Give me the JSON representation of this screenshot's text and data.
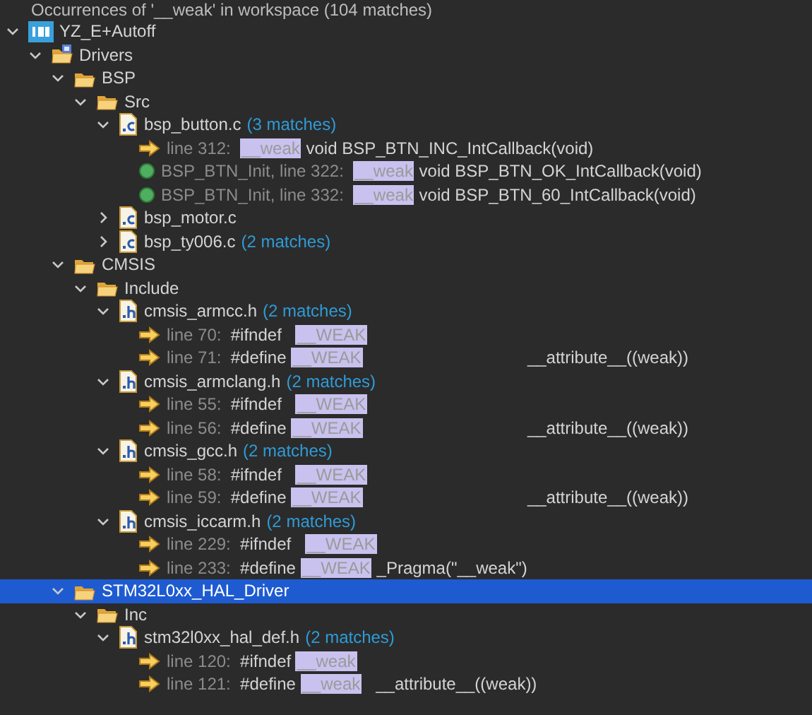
{
  "header": "Occurrences of '__weak' in workspace (104 matches)",
  "tree": [
    {
      "kind": "project",
      "label": "YZ_E+Autoff",
      "expanded": true,
      "selected": false,
      "children": [
        {
          "kind": "source-folder",
          "label": "Drivers",
          "expanded": true,
          "selected": false,
          "children": [
            {
              "kind": "folder",
              "label": "BSP",
              "expanded": true,
              "selected": false,
              "children": [
                {
                  "kind": "folder",
                  "label": "Src",
                  "expanded": true,
                  "selected": false,
                  "children": [
                    {
                      "kind": "c-file",
                      "label": "bsp_button.c",
                      "count": "(3 matches)",
                      "expanded": true,
                      "selected": false,
                      "children": [
                        {
                          "kind": "line-match",
                          "location": "line 312:",
                          "highlight": "__weak",
                          "after": " void BSP_BTN_INC_IntCallback(void)"
                        },
                        {
                          "kind": "method-match",
                          "location": "BSP_BTN_Init, line 322:",
                          "highlight": "__weak",
                          "after": " void BSP_BTN_OK_IntCallback(void)"
                        },
                        {
                          "kind": "method-match",
                          "location": "BSP_BTN_Init, line 332:",
                          "highlight": "__weak",
                          "after": " void BSP_BTN_60_IntCallback(void)"
                        }
                      ]
                    },
                    {
                      "kind": "c-file",
                      "label": "bsp_motor.c",
                      "expanded": false,
                      "selected": false
                    },
                    {
                      "kind": "c-file",
                      "label": "bsp_ty006.c",
                      "count": "(2 matches)",
                      "expanded": false,
                      "selected": false
                    }
                  ]
                }
              ]
            },
            {
              "kind": "folder",
              "label": "CMSIS",
              "expanded": true,
              "selected": false,
              "children": [
                {
                  "kind": "folder",
                  "label": "Include",
                  "expanded": true,
                  "selected": false,
                  "children": [
                    {
                      "kind": "h-file",
                      "label": "cmsis_armcc.h",
                      "count": "(2 matches)",
                      "expanded": true,
                      "selected": false,
                      "children": [
                        {
                          "kind": "line-match",
                          "location": "line 70:",
                          "before": "#ifndef   ",
                          "highlight": "__WEAK"
                        },
                        {
                          "kind": "line-match",
                          "location": "line 71:",
                          "before": "#define ",
                          "highlight": "__WEAK",
                          "after": "                                   __attribute__((weak))"
                        }
                      ]
                    },
                    {
                      "kind": "h-file",
                      "label": "cmsis_armclang.h",
                      "count": "(2 matches)",
                      "expanded": true,
                      "selected": false,
                      "children": [
                        {
                          "kind": "line-match",
                          "location": "line 55:",
                          "before": "#ifndef   ",
                          "highlight": "__WEAK"
                        },
                        {
                          "kind": "line-match",
                          "location": "line 56:",
                          "before": "#define ",
                          "highlight": "__WEAK",
                          "after": "                                   __attribute__((weak))"
                        }
                      ]
                    },
                    {
                      "kind": "h-file",
                      "label": "cmsis_gcc.h",
                      "count": "(2 matches)",
                      "expanded": true,
                      "selected": false,
                      "children": [
                        {
                          "kind": "line-match",
                          "location": "line 58:",
                          "before": "#ifndef   ",
                          "highlight": "__WEAK"
                        },
                        {
                          "kind": "line-match",
                          "location": "line 59:",
                          "before": "#define ",
                          "highlight": "__WEAK",
                          "after": "                                   __attribute__((weak))"
                        }
                      ]
                    },
                    {
                      "kind": "h-file",
                      "label": "cmsis_iccarm.h",
                      "count": "(2 matches)",
                      "expanded": true,
                      "selected": false,
                      "children": [
                        {
                          "kind": "line-match",
                          "location": "line 229:",
                          "before": "#ifndef   ",
                          "highlight": "__WEAK"
                        },
                        {
                          "kind": "line-match",
                          "location": "line 233:",
                          "before": "#define ",
                          "highlight": "__WEAK",
                          "after": " _Pragma(\"__weak\")"
                        }
                      ]
                    }
                  ]
                }
              ]
            },
            {
              "kind": "folder",
              "label": "STM32L0xx_HAL_Driver",
              "expanded": true,
              "selected": true,
              "children": [
                {
                  "kind": "folder",
                  "label": "Inc",
                  "expanded": true,
                  "selected": false,
                  "children": [
                    {
                      "kind": "h-file",
                      "label": "stm32l0xx_hal_def.h",
                      "count": "(2 matches)",
                      "expanded": true,
                      "selected": false,
                      "children": [
                        {
                          "kind": "line-match",
                          "location": "line 120:",
                          "before": "#ifndef ",
                          "highlight": "__weak"
                        },
                        {
                          "kind": "line-match",
                          "location": "line 121:",
                          "before": "#define ",
                          "highlight": "__weak",
                          "after": "   __attribute__((weak))"
                        }
                      ]
                    }
                  ]
                }
              ]
            }
          ]
        }
      ]
    }
  ]
}
